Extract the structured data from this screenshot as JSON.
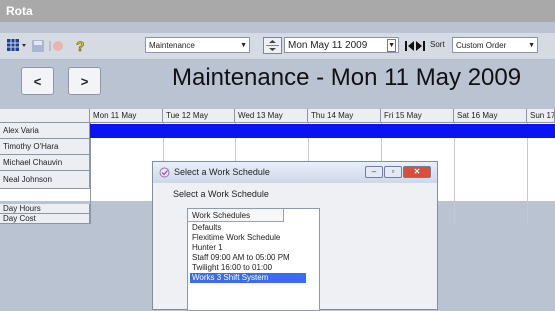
{
  "window": {
    "title": "Rota"
  },
  "toolbar": {
    "department": "Maintenance",
    "date": "Mon May 11 2009",
    "sort_label": "Sort",
    "sort_value": "Custom Order"
  },
  "nav": {
    "prev": "<",
    "next": ">"
  },
  "view_title": "Maintenance - Mon 11 May 2009",
  "grid": {
    "days": [
      "Mon 11 May",
      "Tue 12 May",
      "Wed 13 May",
      "Thu 14 May",
      "Fri 15 May",
      "Sat 16 May",
      "Sun 17"
    ],
    "employees": [
      "Alex Varia",
      "Timothy O'Hara",
      "Michael Chauvin",
      "Neal Johnson"
    ],
    "totals": [
      "Day Hours",
      "Day Cost"
    ]
  },
  "dialog": {
    "title": "Select a Work Schedule",
    "prompt": "Select a Work Schedule",
    "list_header": "Work Schedules",
    "items": [
      "Defaults",
      "Flexitime Work Schedule",
      "Hunter 1",
      "Staff 09:00 AM to 05:00 PM",
      "Twilight 16:00 to 01:00",
      "Works 3 Shift System"
    ],
    "selected_index": 5
  },
  "colors": {
    "row_highlight": "#0a13f0",
    "selection": "#3d6bf0"
  }
}
